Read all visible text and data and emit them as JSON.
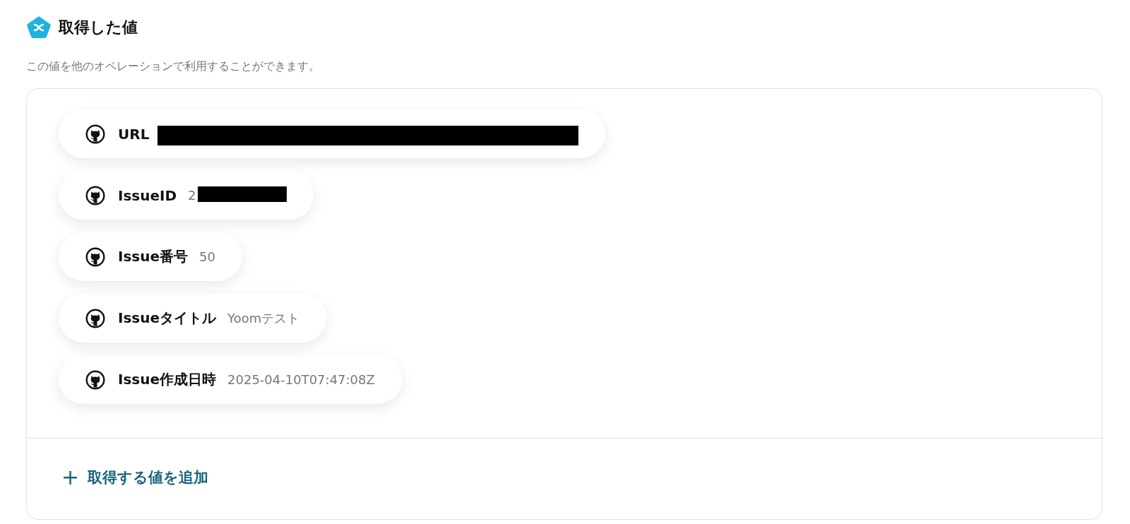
{
  "header": {
    "title": "取得した値",
    "description": "この値を他のオペレーションで利用することができます。"
  },
  "values": [
    {
      "label": "URL",
      "redacted": true
    },
    {
      "label": "IssueID",
      "value": "2",
      "redacted": true
    },
    {
      "label": "Issue番号",
      "value": "50",
      "redacted": false
    },
    {
      "label": "Issueタイトル",
      "value": "Yoomテスト",
      "redacted": false
    },
    {
      "label": "Issue作成日時",
      "value": "2025-04-10T07:47:08Z",
      "redacted": false
    }
  ],
  "add_button": {
    "icon": "+",
    "label": "取得する値を追加"
  }
}
